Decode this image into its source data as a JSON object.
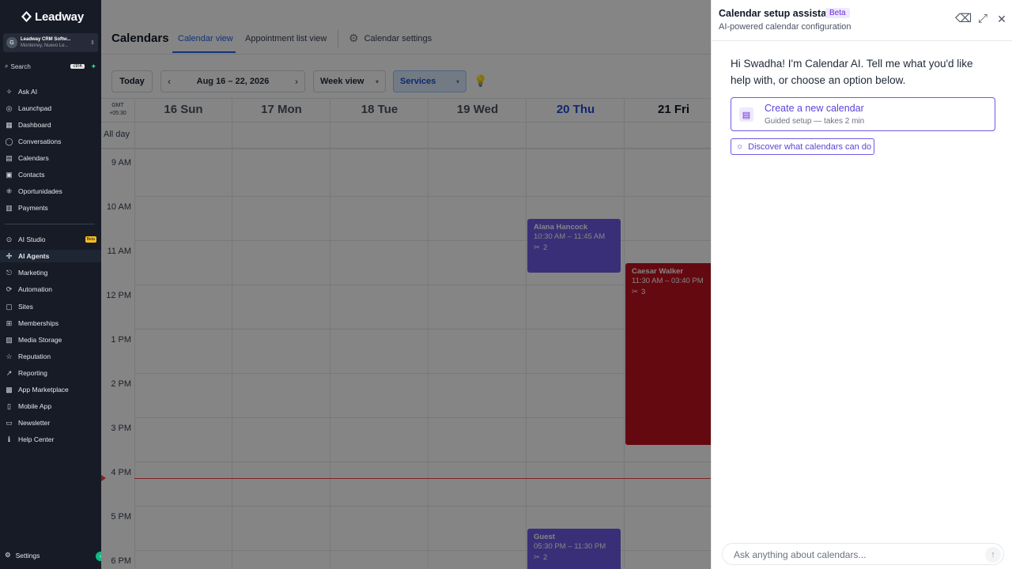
{
  "brand": {
    "name": "Leadway"
  },
  "account": {
    "initial": "G",
    "name": "Leadway CRM Softw...",
    "location": "Monterrey, Nuevo Le..."
  },
  "sidebar": {
    "search_label": "Search",
    "search_shortcut": "ctrlK",
    "items": [
      {
        "label": "Ask AI",
        "icon": "sparkle-icon"
      },
      {
        "label": "Launchpad",
        "icon": "rocket-icon"
      },
      {
        "label": "Dashboard",
        "icon": "dashboard-icon"
      },
      {
        "label": "Conversations",
        "icon": "chat-icon"
      },
      {
        "label": "Calendars",
        "icon": "calendar-icon"
      },
      {
        "label": "Contacts",
        "icon": "contacts-icon"
      },
      {
        "label": "Oportunidades",
        "icon": "funnel-icon"
      },
      {
        "label": "Payments",
        "icon": "payments-icon"
      },
      {
        "label": "AI Studio",
        "icon": "studio-icon",
        "badge": "Beta"
      },
      {
        "label": "AI Agents",
        "icon": "agents-icon"
      },
      {
        "label": "Marketing",
        "icon": "marketing-icon"
      },
      {
        "label": "Automation",
        "icon": "automation-icon"
      },
      {
        "label": "Sites",
        "icon": "sites-icon"
      },
      {
        "label": "Memberships",
        "icon": "memberships-icon"
      },
      {
        "label": "Media Storage",
        "icon": "storage-icon"
      },
      {
        "label": "Reputation",
        "icon": "reputation-icon"
      },
      {
        "label": "Reporting",
        "icon": "reporting-icon"
      },
      {
        "label": "App Marketplace",
        "icon": "marketplace-icon"
      },
      {
        "label": "Mobile App",
        "icon": "mobile-icon"
      },
      {
        "label": "Newsletter",
        "icon": "newsletter-icon"
      },
      {
        "label": "Help Center",
        "icon": "info-icon"
      }
    ],
    "settings_label": "Settings"
  },
  "header": {
    "title": "Calendars",
    "tabs": [
      {
        "label": "Calendar view",
        "active": true
      },
      {
        "label": "Appointment list view"
      },
      {
        "label": "Calendar settings"
      }
    ]
  },
  "toolbar": {
    "today_label": "Today",
    "range": "Aug 16 – 22, 2026",
    "view": "Week view",
    "services": "Services"
  },
  "grid": {
    "timezone_line1": "GMT",
    "timezone_line2": "+05:30",
    "allday_label": "All day",
    "days": [
      {
        "label": "16 Sun"
      },
      {
        "label": "17 Mon"
      },
      {
        "label": "18 Tue"
      },
      {
        "label": "19 Wed"
      },
      {
        "label": "20 Thu",
        "today": true
      },
      {
        "label": "21 Fri"
      }
    ],
    "hours": [
      "9 AM",
      "10 AM",
      "11 AM",
      "12 PM",
      "1 PM",
      "2 PM",
      "3 PM",
      "4 PM",
      "5 PM",
      "6 PM"
    ],
    "events": [
      {
        "name": "Alana Hancock",
        "time": "10:30 AM – 11:45 AM",
        "count": "2",
        "color": "#6d5ae6"
      },
      {
        "name": "Caesar Walker",
        "time": "11:30 AM – 03:40 PM",
        "count": "3",
        "color": "#c1121f"
      },
      {
        "name": "Guest",
        "time": "05:30 PM – 11:30 PM",
        "count": "2",
        "color": "#6d5ae6"
      }
    ]
  },
  "assistant": {
    "title": "Calendar setup assistant",
    "badge": "Beta",
    "subtitle": "AI-powered calendar configuration",
    "greeting": "Hi Swadha! I'm Calendar AI. Tell me what you'd like help with, or choose an option below.",
    "create_title": "Create a new calendar",
    "create_sub": "Guided setup — takes 2 min",
    "discover_label": "Discover what calendars can do",
    "input_placeholder": "Ask anything about calendars..."
  },
  "colors": {
    "accent": "#6d5ae6",
    "primary": "#2563eb",
    "event_red": "#c1121f",
    "sidebar_bg": "#161b26"
  }
}
